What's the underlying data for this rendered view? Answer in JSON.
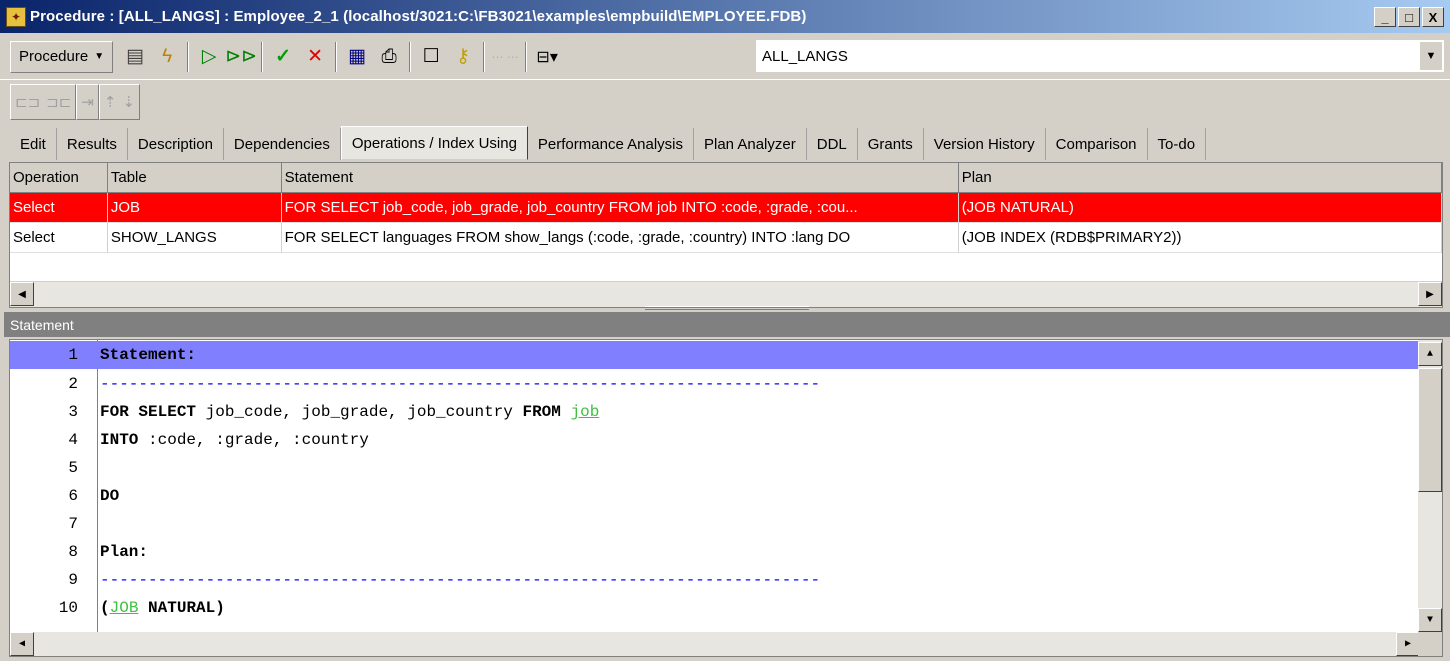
{
  "window": {
    "title": "Procedure : [ALL_LANGS] : Employee_2_1 (localhost/3021:C:\\FB3021\\examples\\empbuild\\EMPLOYEE.FDB)",
    "min": "_",
    "max": "□",
    "close": "X"
  },
  "toolbar": {
    "dropdown_label": "Procedure",
    "selected_procedure": "ALL_LANGS"
  },
  "tabs": [
    "Edit",
    "Results",
    "Description",
    "Dependencies",
    "Operations / Index Using",
    "Performance Analysis",
    "Plan Analyzer",
    "DDL",
    "Grants",
    "Version History",
    "Comparison",
    "To-do"
  ],
  "active_tab_index": 4,
  "operations_grid": {
    "columns": [
      "Operation",
      "Table",
      "Statement",
      "Plan"
    ],
    "rows": [
      {
        "operation": "Select",
        "table": "JOB",
        "statement": "FOR SELECT job_code, job_grade, job_country FROM job INTO :code, :grade, :cou...",
        "plan": "(JOB NATURAL)",
        "selected": true
      },
      {
        "operation": "Select",
        "table": "SHOW_LANGS",
        "statement": "FOR SELECT languages FROM show_langs (:code, :grade, :country) INTO :lang DO",
        "plan": "(JOB INDEX (RDB$PRIMARY2))",
        "selected": false
      }
    ]
  },
  "statement_panel": {
    "header": "Statement",
    "line_numbers": [
      "1",
      "2",
      "3",
      "4",
      "5",
      "6",
      "7",
      "8",
      "9",
      "10"
    ],
    "l1": "Statement:",
    "dashes": "---------------------------------------------------------------------------",
    "l3_kw1": "FOR SELECT",
    "l3_mid": " job_code, job_grade, job_country ",
    "l3_kw2": "FROM",
    "l3_obj": "job",
    "l4_kw": "INTO",
    "l4_rest": " :code, :grade, :country",
    "l6": "DO",
    "l8": "Plan:",
    "l10_open": "(",
    "l10_obj": "JOB",
    "l10_kw": "NATURAL",
    "l10_close": ")"
  },
  "colors": {
    "selected_row": "#ff0000",
    "current_line": "#8080ff",
    "object_link": "#40c040",
    "title_start": "#0a246a"
  }
}
